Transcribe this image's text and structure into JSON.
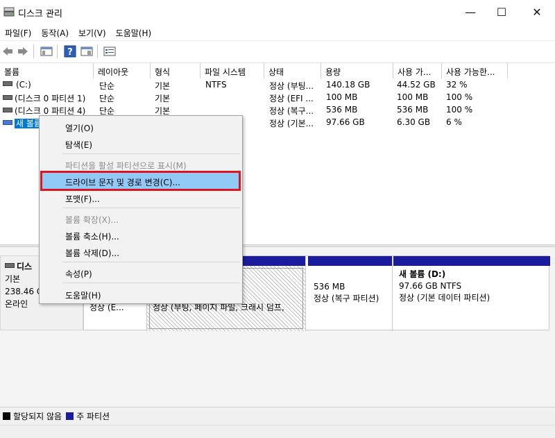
{
  "window": {
    "title": "디스크 관리",
    "minimize": "—",
    "maximize": "☐",
    "close": "✕"
  },
  "menu": [
    "파일(F)",
    "동작(A)",
    "보기(V)",
    "도움말(H)"
  ],
  "toolbar": {
    "icons": [
      "back-arrow-icon",
      "forward-arrow-icon",
      "console-tree-icon",
      "help-icon",
      "properties-icon",
      "list-view-icon"
    ]
  },
  "table": {
    "headers": [
      "볼륨",
      "레이아웃",
      "형식",
      "파일 시스템",
      "상태",
      "용량",
      "사용 가...",
      "사용 가능한..."
    ],
    "rows": [
      {
        "volume": "(C:)",
        "layout": "단순",
        "type": "기본",
        "fs": "NTFS",
        "status": "정상 (부팅...",
        "capacity": "140.18 GB",
        "free": "44.52 GB",
        "pct": "32 %"
      },
      {
        "volume": "(디스크 0 파티션 1)",
        "layout": "단순",
        "type": "기본",
        "fs": "",
        "status": "정상 (EFI ...",
        "capacity": "100 MB",
        "free": "100 MB",
        "pct": "100 %"
      },
      {
        "volume": "(디스크 0 파티션 4)",
        "layout": "단순",
        "type": "기본",
        "fs": "",
        "status": "정상 (복구...",
        "capacity": "536 MB",
        "free": "536 MB",
        "pct": "100 %"
      },
      {
        "volume": "새 볼륨",
        "layout": "",
        "type": "",
        "fs": "",
        "status": "정상 (기본...",
        "capacity": "97.66 GB",
        "free": "6.30 GB",
        "pct": "6 %"
      }
    ]
  },
  "disk": {
    "name": "디스",
    "type": "기본",
    "size": "238.46 G",
    "state": "온라인"
  },
  "partitions": [
    {
      "line1": "",
      "line2": "",
      "line3": "",
      "partial": "정상 (E..."
    },
    {
      "line1": "",
      "line2": "",
      "line3": "",
      "partial": "정상 (부팅, 페이지 파일, 크래시 덤프,"
    },
    {
      "line1": "",
      "line2": "536 MB",
      "line3": "정상 (복구 파티션)"
    },
    {
      "line1": "새 볼륨  (D:)",
      "line2": "97.66 GB NTFS",
      "line3": "정상 (기본 데이터 파티션)"
    }
  ],
  "legend": {
    "unallocated": "할당되지 않음",
    "primary": "주 파티션",
    "unallocated_color": "#000000",
    "primary_color": "#1b1b9e"
  },
  "context_menu": {
    "items": [
      {
        "label": "열기(O)",
        "enabled": true
      },
      {
        "label": "탐색(E)",
        "enabled": true
      },
      {
        "label": "파티션을 활성 파티션으로 표시(M)",
        "enabled": false
      },
      {
        "label": "드라이브 문자 및 경로 변경(C)...",
        "enabled": true,
        "highlighted": true
      },
      {
        "label": "포맷(F)...",
        "enabled": true
      },
      {
        "label": "볼륨 확장(X)...",
        "enabled": false
      },
      {
        "label": "볼륨 축소(H)...",
        "enabled": true
      },
      {
        "label": "볼륨 삭제(D)...",
        "enabled": true
      },
      {
        "label": "속성(P)",
        "enabled": true
      },
      {
        "label": "도움말(H)",
        "enabled": true
      }
    ],
    "highlight_color": "#e0141e"
  }
}
